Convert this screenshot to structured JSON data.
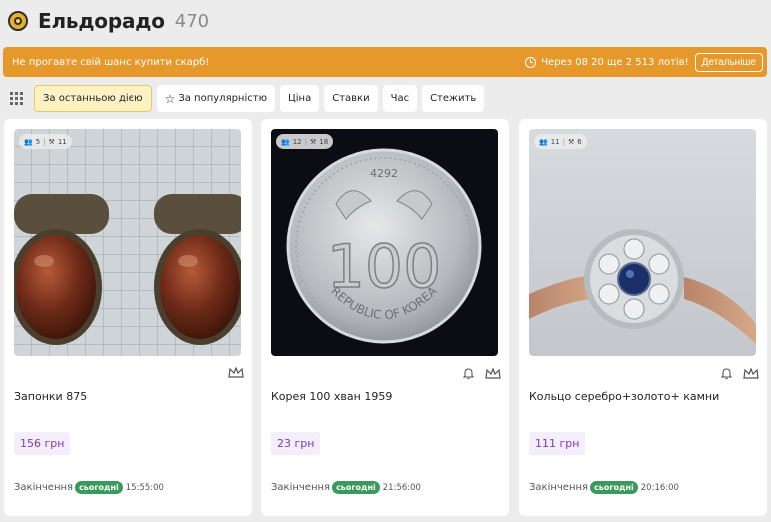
{
  "header": {
    "title": "Ельдорадо",
    "count": "470",
    "logo_icon": "eldorado-logo-icon"
  },
  "banner": {
    "left_text": "Не прогавте свій шанс купити скарб!",
    "right_text": "Через 08 20 ще 2 513 лотів!",
    "details_label": "Детальніше",
    "bg_color": "#e6982b"
  },
  "toolbar": {
    "sort_options": [
      {
        "label": "За останньою дією",
        "active": true
      },
      {
        "label": "За популярністю",
        "icon": "star-icon"
      },
      {
        "label": "Ціна"
      },
      {
        "label": "Ставки"
      },
      {
        "label": "Час"
      },
      {
        "label": "Стежить"
      }
    ]
  },
  "lots": [
    {
      "title": "Запонки 875",
      "price": "156 грн",
      "watchers": "5",
      "bids": "11",
      "ending_label": "Закінчення",
      "today_label": "сьогодні",
      "time": "15:55:00",
      "has_bell": false
    },
    {
      "title": "Корея 100 хван 1959",
      "price": "23 грн",
      "watchers": "12",
      "bids": "18",
      "ending_label": "Закінчення",
      "today_label": "сьогодні",
      "time": "21:56:00",
      "has_bell": true,
      "coin_text": {
        "year": "4292",
        "value": "100",
        "legend": "REPUBLIC OF KOREA"
      }
    },
    {
      "title": "Кольцо серебро+золото+ камни",
      "price": "111 грн",
      "watchers": "11",
      "bids": "6",
      "ending_label": "Закінчення",
      "today_label": "сьогодні",
      "time": "20:16:00",
      "has_bell": true
    }
  ],
  "colors": {
    "accent": "#e6982b",
    "price": "#7a3db0",
    "today_badge": "#3a9a5c"
  }
}
